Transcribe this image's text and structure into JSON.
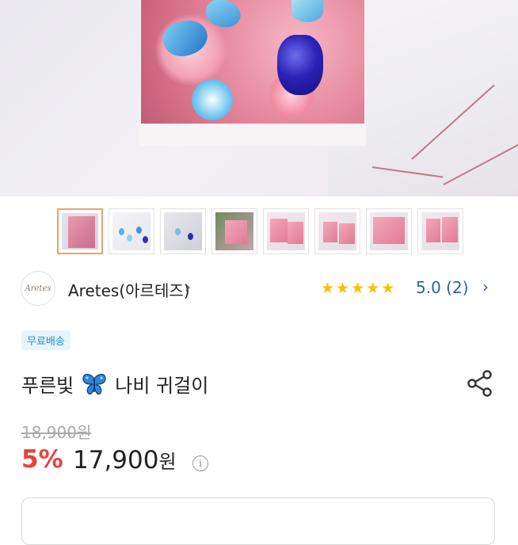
{
  "seller": {
    "logo_text": "Aretes",
    "name": "Aretes(아르테즈)",
    "chevron": "›",
    "stars": [
      "★",
      "★",
      "★",
      "★",
      "★"
    ],
    "rating": "5.0 (2)",
    "rating_chevron": "›"
  },
  "badge": "무료배송",
  "product": {
    "title_before": "푸른빛",
    "title_icon": "butterfly-emoji",
    "title_after": "나비 귀걸이"
  },
  "price": {
    "original": "18,900원",
    "discount": "5%",
    "current": "17,900",
    "currency": "원",
    "info_icon": "i"
  },
  "thumbnails": {
    "count": 8,
    "active_index": 0
  },
  "colors": {
    "discount_red": "#e8433a",
    "rating_blue": "#2f5fb3",
    "star_yellow": "#f6c200",
    "badge_bg": "#e7f4fb",
    "badge_text": "#1b8fd1",
    "active_thumb_border": "#f0a06a"
  }
}
